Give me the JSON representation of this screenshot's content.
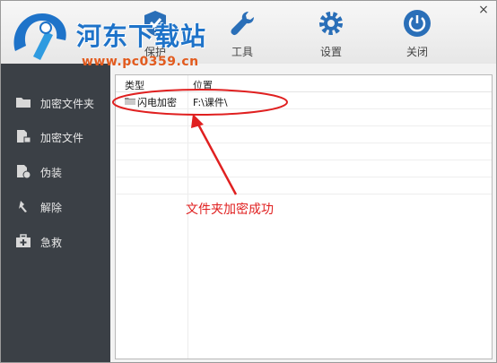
{
  "window": {
    "close_glyph": "×"
  },
  "toolbar": {
    "items": [
      {
        "label": "保护",
        "icon": "shield-icon"
      },
      {
        "label": "工具",
        "icon": "wrench-icon"
      },
      {
        "label": "设置",
        "icon": "gear-icon"
      },
      {
        "label": "关闭",
        "icon": "power-icon"
      }
    ]
  },
  "watermark": {
    "title": "河东下载站",
    "url": "www.pc0359.cn"
  },
  "sidebar": {
    "items": [
      {
        "label": "加密文件夹",
        "icon": "folder-icon"
      },
      {
        "label": "加密文件",
        "icon": "file-lock-icon"
      },
      {
        "label": "伪装",
        "icon": "disguise-icon"
      },
      {
        "label": "解除",
        "icon": "unlock-icon"
      },
      {
        "label": "急救",
        "icon": "first-aid-icon"
      }
    ]
  },
  "table": {
    "columns": [
      "类型",
      "位置"
    ],
    "rows": [
      {
        "type": "闪电加密",
        "location": "F:\\课件\\"
      }
    ]
  },
  "annotation": {
    "text": "文件夹加密成功",
    "color": "#e02020"
  },
  "colors": {
    "sidebar_bg": "#3b4046",
    "accent_blue": "#1e73c9",
    "annotation_red": "#e02020"
  }
}
